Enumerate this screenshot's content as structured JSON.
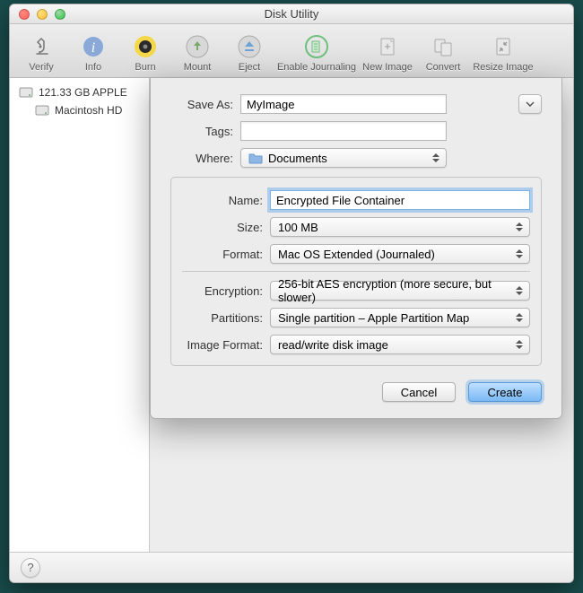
{
  "window": {
    "title": "Disk Utility"
  },
  "toolbar": {
    "items": [
      {
        "label": "Verify"
      },
      {
        "label": "Info"
      },
      {
        "label": "Burn"
      },
      {
        "label": "Mount"
      },
      {
        "label": "Eject"
      },
      {
        "label": "Enable Journaling"
      },
      {
        "label": "New Image"
      },
      {
        "label": "Convert"
      },
      {
        "label": "Resize Image"
      }
    ]
  },
  "sidebar": {
    "disk": {
      "label": "121.33 GB APPLE"
    },
    "volume": {
      "label": "Macintosh HD"
    }
  },
  "sheet": {
    "save_as_label": "Save As:",
    "save_as_value": "MyImage",
    "tags_label": "Tags:",
    "tags_value": "",
    "where_label": "Where:",
    "where_value": "Documents",
    "name_label": "Name:",
    "name_value": "Encrypted File Container",
    "size_label": "Size:",
    "size_value": "100 MB",
    "format_label": "Format:",
    "format_value": "Mac OS Extended (Journaled)",
    "encryption_label": "Encryption:",
    "encryption_value": "256-bit AES encryption (more secure, but slower)",
    "partitions_label": "Partitions:",
    "partitions_value": "Single partition – Apple Partition Map",
    "image_format_label": "Image Format:",
    "image_format_value": "read/write disk image",
    "cancel_label": "Cancel",
    "create_label": "Create"
  },
  "help": {
    "glyph": "?"
  }
}
